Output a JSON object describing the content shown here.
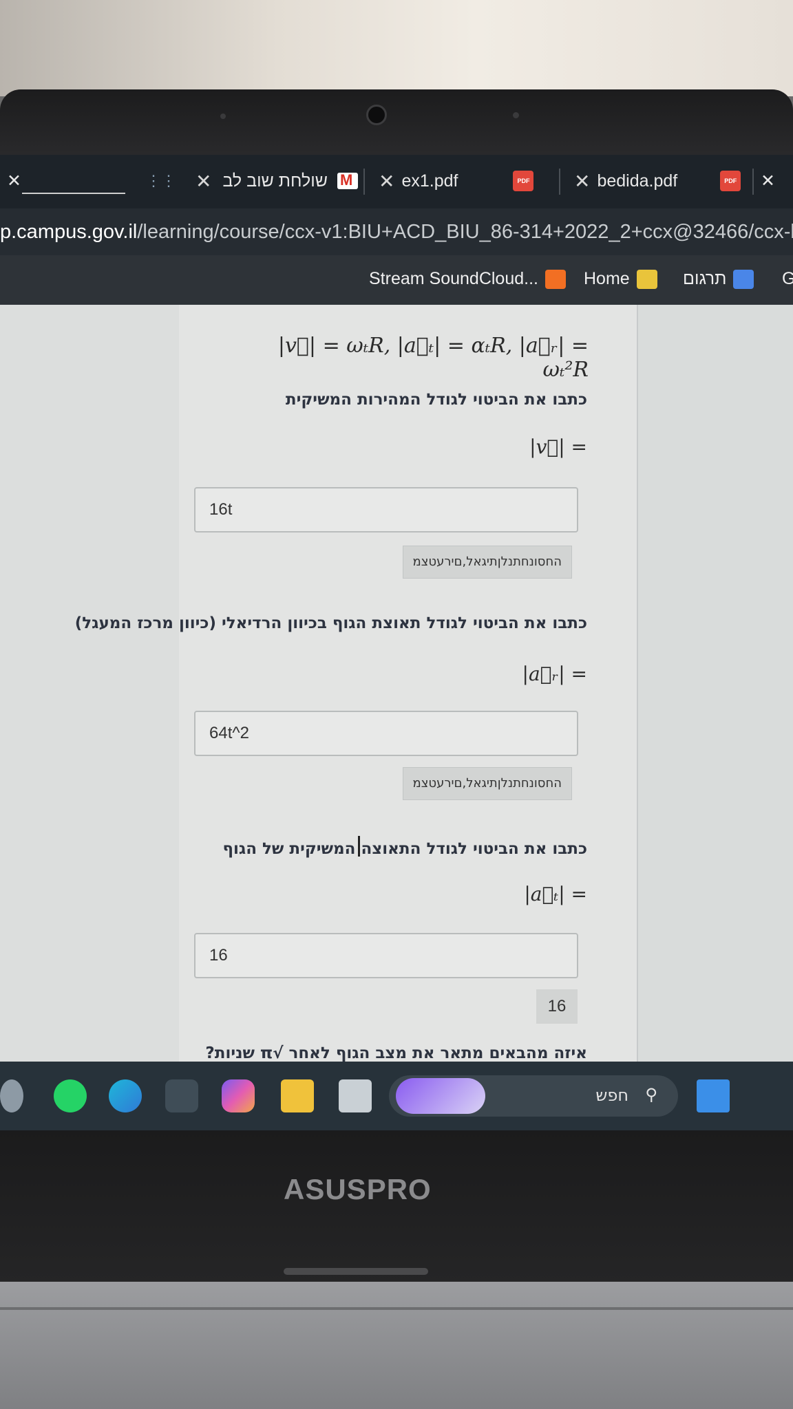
{
  "browser": {
    "tabs": [
      {
        "label": "bedida.pdf",
        "close": "✕",
        "icon": "pdf-icon"
      },
      {
        "label": "ex1.pdf",
        "close": "✕",
        "icon": "pdf-icon"
      },
      {
        "label": "שולחת שוב לב",
        "close": "✕",
        "icon": "gmail-icon"
      }
    ],
    "pdf_icon_text": "PDF",
    "far_close": "✕",
    "window_close": "✕",
    "url_host": "p.campus.gov.il",
    "url_path": "/learning/course/ccx-v1:BIU+ACD_BIU_86-314+2022_2+ccx@32466/ccx-block",
    "bookmarks": [
      {
        "label": "Stream SoundCloud...",
        "icon": "soundcloud-icon"
      },
      {
        "label": "Home",
        "icon": "home-icon"
      },
      {
        "label": "תרגום",
        "icon": "google-translate-icon"
      },
      {
        "label": "G",
        "icon": ""
      }
    ]
  },
  "problem": {
    "formula": "|v⃗| = ωₜR, |a⃗ₜ| = αₜR, |a⃗ᵣ| = ωₜ²R",
    "questions": [
      {
        "prompt": "כתבו את הביטוי לגודל המהירות המשיקית",
        "equation": "|v⃗| =",
        "answer": "16t",
        "preview": "החסונחתנלןתיגאל,םירעטצמ"
      },
      {
        "prompt": "כתבו את הביטוי לגודל תאוצת הגוף בכיוון הרדיאלי (כיוון מרכז המעגל)",
        "equation": "|a⃗ᵣ| =",
        "answer": "64t^2",
        "preview": "החסונחתנלןתיגאל,םירעטצמ"
      },
      {
        "prompt": "כתבו את הביטוי לגודל התאוצה המשיקית של הגוף",
        "equation": "|a⃗ₜ| =",
        "answer": "16",
        "preview": "16"
      }
    ],
    "next_prompt": "איזה מהבאים מתאר את מצב הגוף לאחר √π שניות?"
  },
  "taskbar": {
    "search_label": "חפש",
    "apps": [
      "start-icon",
      "search-icon",
      "widget-icon",
      "task-view-icon",
      "file-explorer-icon",
      "copilot-icon",
      "store-icon",
      "edge-icon",
      "whatsapp-icon",
      "settings-icon"
    ]
  },
  "laptop": {
    "brand": "ASUSPRO"
  },
  "colors": {
    "tabbar": "#1d2329",
    "urlbar": "#262c32",
    "page_bg": "#e3e4e3",
    "question_text": "#2d3340",
    "pdf_red": "#e2473b"
  }
}
